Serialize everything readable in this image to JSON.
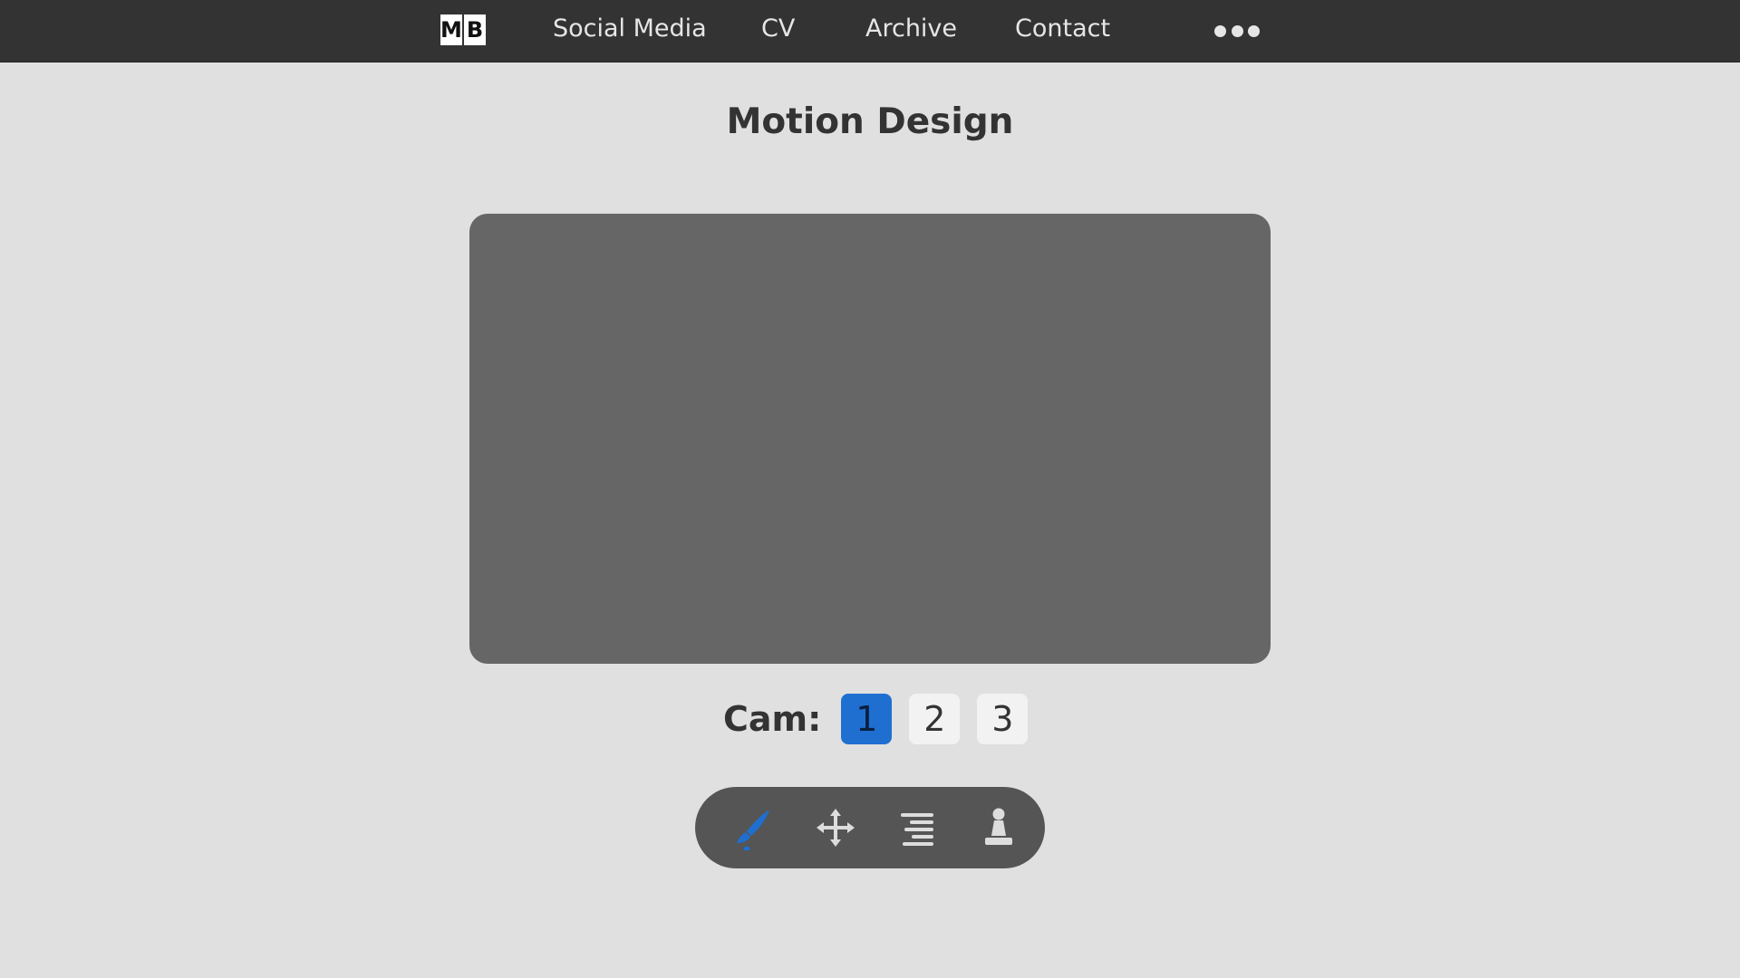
{
  "nav": {
    "logo_left": "M",
    "logo_right": "B",
    "links": [
      "Social Media",
      "CV",
      "Archive",
      "Contact"
    ]
  },
  "page": {
    "title": "Motion Design"
  },
  "camera": {
    "label": "Cam:",
    "options": [
      "1",
      "2",
      "3"
    ],
    "selected": "1"
  },
  "toolbar": {
    "tools": [
      "brush-icon",
      "move-icon",
      "align-right-icon",
      "pawn-icon"
    ],
    "active_tool": "brush-icon"
  },
  "colors": {
    "accent": "#1f6fd1",
    "topbar": "#333333",
    "background": "#e0e0e0",
    "viewport": "#666666",
    "toolbar": "#555555",
    "icon": "#dddddd"
  }
}
